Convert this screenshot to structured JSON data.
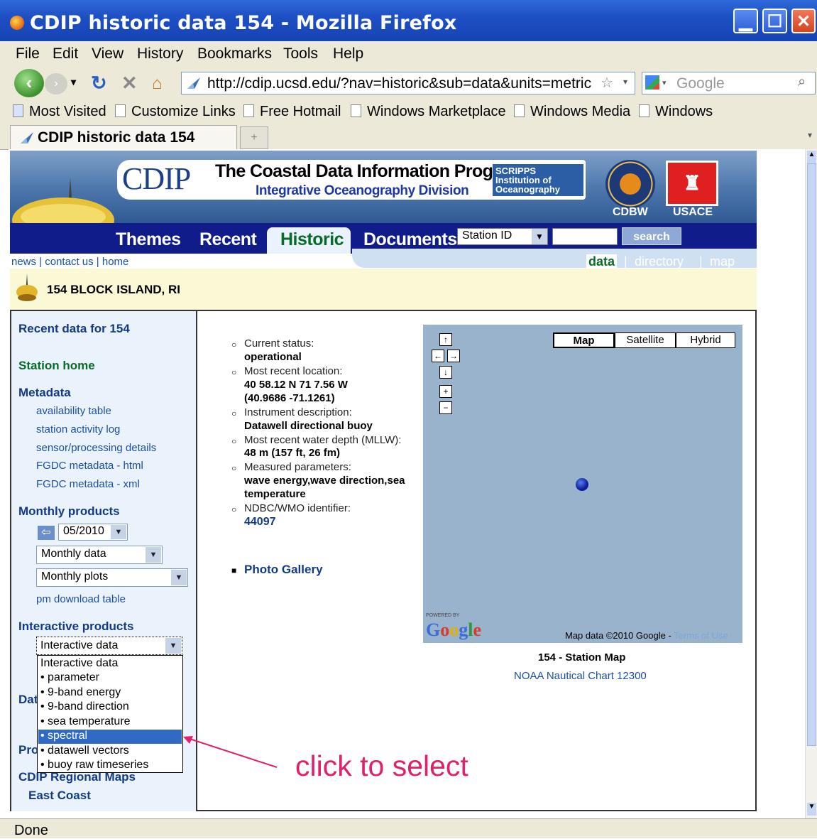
{
  "window": {
    "title": "CDIP historic data 154 - Mozilla Firefox",
    "minimize_glyph": "▁",
    "maximize_glyph": "☐",
    "close_glyph": "✕"
  },
  "menubar": [
    "File",
    "Edit",
    "View",
    "History",
    "Bookmarks",
    "Tools",
    "Help"
  ],
  "navigation": {
    "url": "http://cdip.ucsd.edu/?nav=historic&sub=data&units=metric",
    "search_placeholder": "Google"
  },
  "bookmarks": [
    "Most Visited",
    "Customize Links",
    "Free Hotmail",
    "Windows Marketplace",
    "Windows Media",
    "Windows"
  ],
  "tabs": [
    {
      "label": "CDIP historic data 154"
    }
  ],
  "new_tab_glyph": "+",
  "header": {
    "logo_text": "CDIP",
    "program_title": "The Coastal Data Information Program",
    "program_subtitle": "Integrative Oceanography Division",
    "scripps_line1": "SCRIPPS",
    "scripps_line2": "Institution of",
    "scripps_line3": "Oceanography",
    "cdbw_label": "CDBW",
    "usace_label": "USACE"
  },
  "site_nav": {
    "tabs": [
      "Themes",
      "Recent",
      "Historic",
      "Documents"
    ],
    "active_tab": "Historic",
    "station_select": "Station ID",
    "search_button": "search"
  },
  "top_links": "news | contact us | home",
  "sub_nav": {
    "active": "data",
    "items": [
      "directory",
      "map"
    ],
    "separator": "|"
  },
  "station": {
    "name": "154 BLOCK ISLAND, RI"
  },
  "sidebar": {
    "recent_heading": "Recent data for 154",
    "station_home": "Station home",
    "metadata_heading": "Metadata",
    "metadata_links": [
      "availability table",
      "station activity log",
      "sensor/processing details",
      "FGDC metadata - html",
      "FGDC metadata - xml"
    ],
    "monthly_heading": "Monthly products",
    "month_value": "05/2010",
    "monthly_data_select": "Monthly data",
    "monthly_plots_select": "Monthly plots",
    "download_link": "pm download table",
    "interactive_heading": "Interactive products",
    "interactive_select": "Interactive data",
    "dropdown_options": [
      "Interactive data",
      "parameter",
      "9-band energy",
      "9-band direction",
      "sea temperature",
      "spectral",
      "datawell vectors",
      "buoy raw timeseries"
    ],
    "dropdown_selected": "spectral",
    "hidden_partial_1": "Dat",
    "hidden_partial_2": "Pro",
    "regional_heading": "CDIP Regional Maps",
    "east_coast": "East Coast"
  },
  "info": [
    {
      "label": "Current status:",
      "value": "operational"
    },
    {
      "label": "Most recent location:",
      "value": "40 58.12 N 71 7.56 W",
      "value2": "(40.9686 -71.1261)"
    },
    {
      "label": "Instrument description:",
      "value": "Datawell directional buoy"
    },
    {
      "label": "Most recent water depth (MLLW):",
      "value": "48 m  (157 ft, 26 fm)"
    },
    {
      "label": "Measured parameters:",
      "value": "wave energy,wave direction,sea",
      "value2": "temperature"
    },
    {
      "label": "NDBC/WMO identifier:",
      "value": "44097"
    }
  ],
  "photo_gallery": "Photo Gallery",
  "map": {
    "buttons": [
      "Map",
      "Satellite",
      "Hybrid"
    ],
    "active": "Map",
    "powered_by": "POWERED BY",
    "google_logo": "Google",
    "copyright": "Map data ©2010 Google - ",
    "terms": "Terms of Use",
    "caption": "154 - Station Map",
    "chart_link": "NOAA Nautical Chart 12300"
  },
  "annotation": "click to select",
  "status": "Done",
  "colors": {
    "annotation": "#e0206a",
    "nav_bg": "#0f1c8a",
    "link": "#1b4fa3",
    "green": "#0a6a2a"
  }
}
